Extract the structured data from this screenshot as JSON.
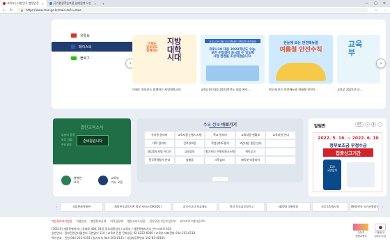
{
  "browser": {
    "tabs": [
      {
        "label": "교육부 | 대한민국 행정안전"
      },
      {
        "label": "국가평생학습포털 늘배움에 오신"
      }
    ],
    "url": "https://www.moe.go.kr/main.do?s=moe",
    "window_controls": [
      "—",
      "▢",
      "✕"
    ]
  },
  "sns": {
    "items": [
      {
        "label": "유튜브",
        "icon": "youtube-icon"
      },
      {
        "label": "페이스북",
        "icon": "facebook-icon"
      },
      {
        "label": "블로그",
        "icon": "blog-icon"
      }
    ]
  },
  "carousel": {
    "prev": "‹",
    "next": "›",
    "cards": [
      {
        "caption": "이제는 알모로도 함께하는 지방대학시대",
        "art_title": "지방\n대학\n시대",
        "art_sub": "이제는\n알모로도\n함께하는"
      },
      {
        "caption": "교육나19 대응 2023학년도 대입 관리...",
        "art_title": "코로나19 대응 2023학년도 수능,\n모든 수험생이 응시할 수 있도록\n시험 환경을 조성하겠습니다.",
        "art_sub": "코로나19 대응 2023학년도 대학입학 관리방안"
      },
      {
        "caption": "한눈에 보는 안전매뉴얼 여름철 안전수...",
        "art_title": "여름철 안전수칙",
        "art_sub": "한눈에 보는 안전매뉴얼"
      },
      {
        "caption": "교육부 2022년 상...",
        "art_title": "교육\n부",
        "art_sub": ""
      }
    ]
  },
  "news": {
    "title": "열린교육소식",
    "list": [
      "부총리 동정",
      "보도 자료",
      "주요일정"
    ],
    "live_label": "준비중입니다",
    "buttons": [
      {
        "label": "행복한\n교육"
      },
      {
        "label": "교육부\n기사 모음"
      }
    ]
  },
  "info": {
    "title_prefix": "주요 정보",
    "title_bold": "바로가기",
    "cells": [
      "유치원 알리미",
      "교육지원 신청시스템",
      "학교 알리미",
      "교육지원 현황보",
      "교육지원 안내",
      "대학 알리미",
      "진로정보망",
      "학업성취도평가",
      "고입대입 종합 안내",
      "",
      "대입정보포털 어디가",
      "교실양보",
      "평가보다 수행지원시스템",
      "케이무크",
      "",
      "전국학력평가 안내",
      "늘배움",
      "e학습터",
      "에듀넷·티클리어",
      ""
    ],
    "more": "···"
  },
  "alarm": {
    "title": "알림판",
    "page": "4/5",
    "prev": "‹",
    "next": "›",
    "pause": "Ⅱ",
    "poster_date": "2022. 5. 16. ~ 2022. 6. 10",
    "poster_line1": "정부보조금 부정수급",
    "poster_line2": "집중신고기간",
    "poster_phone": "110\n국번없이"
  },
  "banners": {
    "prev": "‹",
    "next": "›",
    "items": [
      "국립한글박물관",
      "제외한국교육기관 정보 서비스(OKEDU)",
      "공익신고자 보호제도",
      "복지 보조금부정신고",
      "제20대 대통령실",
      "국무조정실사실",
      "대통령직속 국가균형발전"
    ]
  },
  "footer": {
    "links": [
      "개인정보처리방침",
      "이용안내",
      "행정정보공개",
      "저작권정책",
      "행정서비스헌장",
      "전자우편 무단수집거부",
      "뷰어프로그램다운로드"
    ],
    "addr_lines": [
      "[30119] 세종특별자치시 갈매로 408, 14동 정부세종청사 / 교육부 / 세종특별자치시 한누리대로 434",
      "일반안내 : 정부민원안내콜센터 국번없이 110 / 교육부 민원 전화상담 02-6222-6060 / 교육부 대표전화 044-203-6118",
      "팩스번호 : 민원 044-203-6393 / 청사부속 044-203-6133 / 사업자등록번호 102-83-00181"
    ],
    "logo1": "이미지\n청렴교육부",
    "logo2": "대한민국\n정부누리집"
  }
}
